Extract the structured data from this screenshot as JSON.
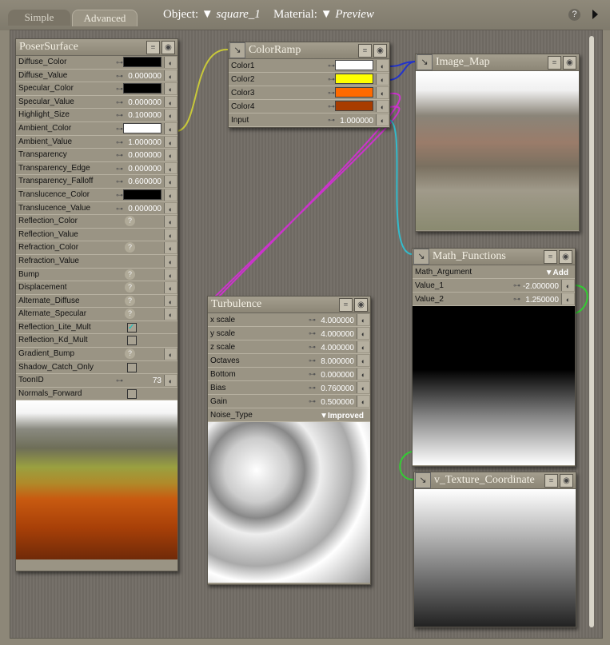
{
  "tabs": {
    "simple": "Simple",
    "advanced": "Advanced"
  },
  "header": {
    "object_label": "Object:",
    "object_value": "square_1",
    "material_label": "Material:",
    "material_value": "Preview",
    "help": "?"
  },
  "poser_surface": {
    "title": "PoserSurface",
    "rows": [
      [
        "Diffuse_Color",
        "color",
        "#000000"
      ],
      [
        "Diffuse_Value",
        "num",
        "0.000000"
      ],
      [
        "Specular_Color",
        "color",
        "#000000"
      ],
      [
        "Specular_Value",
        "num",
        "0.000000"
      ],
      [
        "Highlight_Size",
        "num",
        "0.100000"
      ],
      [
        "Ambient_Color",
        "color",
        "#ffffff"
      ],
      [
        "Ambient_Value",
        "num",
        "1.000000"
      ],
      [
        "Transparency",
        "num",
        "0.000000"
      ],
      [
        "Transparency_Edge",
        "num",
        "0.000000"
      ],
      [
        "Transparency_Falloff",
        "num",
        "0.600000"
      ],
      [
        "Translucence_Color",
        "color",
        "#000000"
      ],
      [
        "Translucence_Value",
        "num",
        "0.000000"
      ],
      [
        "Reflection_Color",
        "q",
        ""
      ],
      [
        "Reflection_Value",
        "plain",
        ""
      ],
      [
        "Refraction_Color",
        "q",
        ""
      ],
      [
        "Refraction_Value",
        "plain",
        ""
      ],
      [
        "Bump",
        "q",
        ""
      ],
      [
        "Displacement",
        "q",
        ""
      ],
      [
        "Alternate_Diffuse",
        "q",
        ""
      ],
      [
        "Alternate_Specular",
        "q",
        ""
      ],
      [
        "Reflection_Lite_Mult",
        "check",
        "true"
      ],
      [
        "Reflection_Kd_Mult",
        "check",
        "false"
      ],
      [
        "Gradient_Bump",
        "q",
        ""
      ],
      [
        "Shadow_Catch_Only",
        "check",
        "false"
      ],
      [
        "ToonID",
        "num",
        "73"
      ],
      [
        "Normals_Forward",
        "check",
        "false"
      ]
    ]
  },
  "color_ramp": {
    "title": "ColorRamp",
    "rows": [
      [
        "Color1",
        "color",
        "#ffffff"
      ],
      [
        "Color2",
        "color",
        "#ffff00"
      ],
      [
        "Color3",
        "color",
        "#ff6a00"
      ],
      [
        "Color4",
        "color",
        "#a83c00"
      ],
      [
        "Input",
        "num",
        "1.000000"
      ]
    ]
  },
  "image_map": {
    "title": "Image_Map"
  },
  "math_functions": {
    "title": "Math_Functions",
    "rows": [
      [
        "Math_Argument",
        "select",
        "Add"
      ],
      [
        "Value_1",
        "num",
        "-2.000000"
      ],
      [
        "Value_2",
        "num",
        "1.250000"
      ]
    ]
  },
  "turbulence": {
    "title": "Turbulence",
    "rows": [
      [
        "x scale",
        "num",
        "4.000000"
      ],
      [
        "y scale",
        "num",
        "4.000000"
      ],
      [
        "z scale",
        "num",
        "4.000000"
      ],
      [
        "Octaves",
        "num",
        "8.000000"
      ],
      [
        "Bottom",
        "num",
        "0.000000"
      ],
      [
        "Bias",
        "num",
        "0.760000"
      ],
      [
        "Gain",
        "num",
        "0.500000"
      ],
      [
        "Noise_Type",
        "select",
        "Improved"
      ]
    ]
  },
  "v_texture": {
    "title": "v_Texture_Coordinate"
  }
}
